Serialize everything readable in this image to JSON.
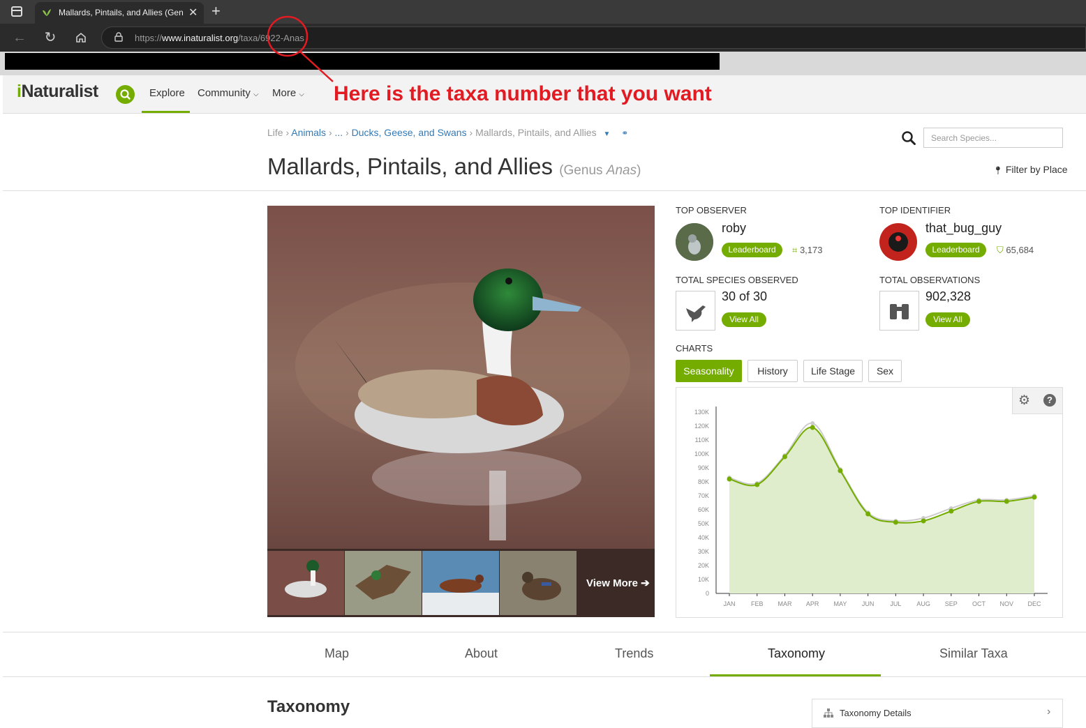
{
  "browser": {
    "tab_title": "Mallards, Pintails, and Allies (Genus Anas) · iNaturalist",
    "url_prefix": "https://",
    "url_domain": "www.inaturalist.org",
    "url_path": "/taxa/6922-Anas"
  },
  "annotation": {
    "text": "Here is the taxa number that you want",
    "color": "#e21b23"
  },
  "header": {
    "logo_prefix": "i",
    "logo_rest": "Naturalist",
    "nav": {
      "explore": "Explore",
      "community": "Community",
      "more": "More"
    }
  },
  "breadcrumb": {
    "life": "Life",
    "animals": "Animals",
    "ellipsis": "...",
    "ducks": "Ducks, Geese, and Swans",
    "current": "Mallards, Pintails, and Allies"
  },
  "title": {
    "common_name": "Mallards, Pintails, and Allies",
    "rank": "Genus",
    "scientific_name": "Anas"
  },
  "search": {
    "placeholder": "Search Species..."
  },
  "filter_by_place": "Filter by Place",
  "photos": {
    "view_more": "View More"
  },
  "stats": {
    "top_observer": {
      "label": "Top Observer",
      "name": "roby",
      "button": "Leaderboard",
      "count": "3,173"
    },
    "top_identifier": {
      "label": "Top Identifier",
      "name": "that_bug_guy",
      "button": "Leaderboard",
      "count": "65,684"
    },
    "total_species": {
      "label": "Total Species Observed",
      "value": "30 of 30",
      "button": "View All"
    },
    "total_observations": {
      "label": "Total Observations",
      "value": "902,328",
      "button": "View All"
    }
  },
  "charts": {
    "label": "Charts",
    "tabs": [
      "Seasonality",
      "History",
      "Life Stage",
      "Sex"
    ],
    "active_tab": "Seasonality"
  },
  "chart_data": {
    "type": "area",
    "title": "",
    "xlabel": "",
    "ylabel": "",
    "categories": [
      "JAN",
      "FEB",
      "MAR",
      "APR",
      "MAY",
      "JUN",
      "JUL",
      "AUG",
      "SEP",
      "OCT",
      "NOV",
      "DEC"
    ],
    "y_ticks": [
      "0",
      "10K",
      "20K",
      "30K",
      "40K",
      "50K",
      "60K",
      "70K",
      "80K",
      "90K",
      "100K",
      "110K",
      "120K",
      "130K"
    ],
    "ylim": [
      0,
      130000
    ],
    "series": [
      {
        "values": [
          82000,
          78000,
          98000,
          119000,
          88000,
          57000,
          51000,
          52000,
          59000,
          66000,
          66000,
          69000
        ],
        "color": "#74ac00",
        "fill": "#e0edcc"
      },
      {
        "values": [
          83000,
          79000,
          99000,
          122000,
          89000,
          58000,
          52000,
          54000,
          61000,
          67000,
          67000,
          70000
        ],
        "color": "#cccccc"
      }
    ],
    "grid": false
  },
  "tabs": {
    "items": [
      "Map",
      "About",
      "Trends",
      "Taxonomy",
      "Similar Taxa"
    ],
    "active": "Taxonomy"
  },
  "taxonomy": {
    "section_title": "Taxonomy",
    "details_label": "Taxonomy Details"
  },
  "colors": {
    "brand_green": "#74ac00",
    "link_blue": "#337ab7"
  }
}
